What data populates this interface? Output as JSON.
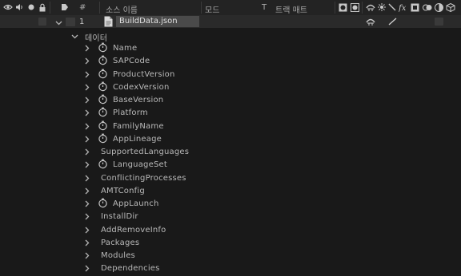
{
  "header": {
    "hash": "#",
    "source_name": "소스 이름",
    "mode": "모드",
    "t": "T",
    "track_matte": "트랙 매트"
  },
  "layer": {
    "number": "1",
    "name": "BuildData.json"
  },
  "group": {
    "label": "데이터"
  },
  "properties": [
    {
      "label": "Name",
      "stopwatch": true
    },
    {
      "label": "SAPCode",
      "stopwatch": true
    },
    {
      "label": "ProductVersion",
      "stopwatch": true
    },
    {
      "label": "CodexVersion",
      "stopwatch": true
    },
    {
      "label": "BaseVersion",
      "stopwatch": true
    },
    {
      "label": "Platform",
      "stopwatch": true
    },
    {
      "label": "FamilyName",
      "stopwatch": true
    },
    {
      "label": "AppLineage",
      "stopwatch": true
    },
    {
      "label": "SupportedLanguages",
      "stopwatch": false
    },
    {
      "label": "LanguageSet",
      "stopwatch": true
    },
    {
      "label": "ConflictingProcesses",
      "stopwatch": false
    },
    {
      "label": "AMTConfig",
      "stopwatch": false
    },
    {
      "label": "AppLaunch",
      "stopwatch": true
    },
    {
      "label": "InstallDir",
      "stopwatch": false
    },
    {
      "label": "AddRemoveInfo",
      "stopwatch": false
    },
    {
      "label": "Packages",
      "stopwatch": false
    },
    {
      "label": "Modules",
      "stopwatch": false
    },
    {
      "label": "Dependencies",
      "stopwatch": false
    }
  ]
}
